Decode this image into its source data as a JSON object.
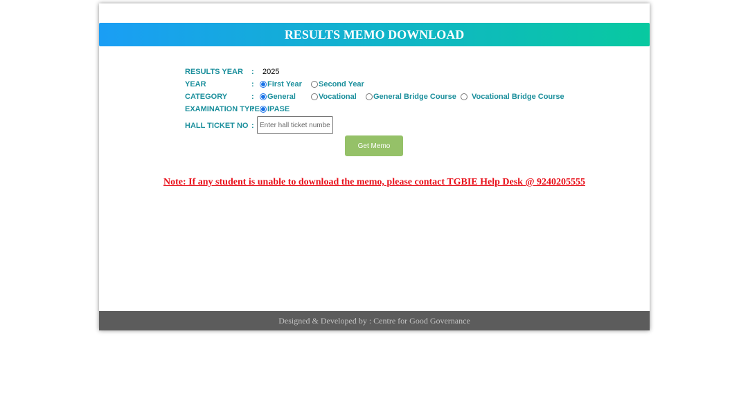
{
  "header": {
    "title": "RESULTS MEMO DOWNLOAD"
  },
  "form": {
    "results_year": {
      "label": "RESULTS YEAR",
      "colon": ":",
      "value": "2025"
    },
    "year": {
      "label": "YEAR",
      "colon": ":",
      "options": [
        {
          "label": "First Year",
          "checked": true
        },
        {
          "label": "Second Year",
          "checked": false
        }
      ]
    },
    "category": {
      "label": "CATEGORY",
      "colon": ":",
      "options": [
        {
          "label": "General",
          "checked": true
        },
        {
          "label": "Vocational",
          "checked": false
        },
        {
          "label": "General Bridge Course",
          "checked": false
        },
        {
          "label": "Vocational Bridge Course",
          "checked": false
        }
      ]
    },
    "exam_type": {
      "label": "EXAMINATION TYPE",
      "colon": ":",
      "options": [
        {
          "label": "IPASE",
          "checked": true
        }
      ]
    },
    "hall_ticket": {
      "label": "HALL TICKET NO",
      "colon": ":",
      "placeholder": "Enter hall ticket number",
      "value": ""
    },
    "submit_label": "Get Memo"
  },
  "note": "Note: If any student is unable to download the memo, please contact TGBIE Help Desk @ 9240205555",
  "footer": {
    "text": "Designed & Developed by : Centre for Good Governance"
  },
  "colors": {
    "header_start": "#1a9ef5",
    "header_end": "#08c9a0",
    "label": "#1b8f9c",
    "note": "#e8101a",
    "button": "#95c168",
    "footer_bg": "#5c5c5c"
  }
}
